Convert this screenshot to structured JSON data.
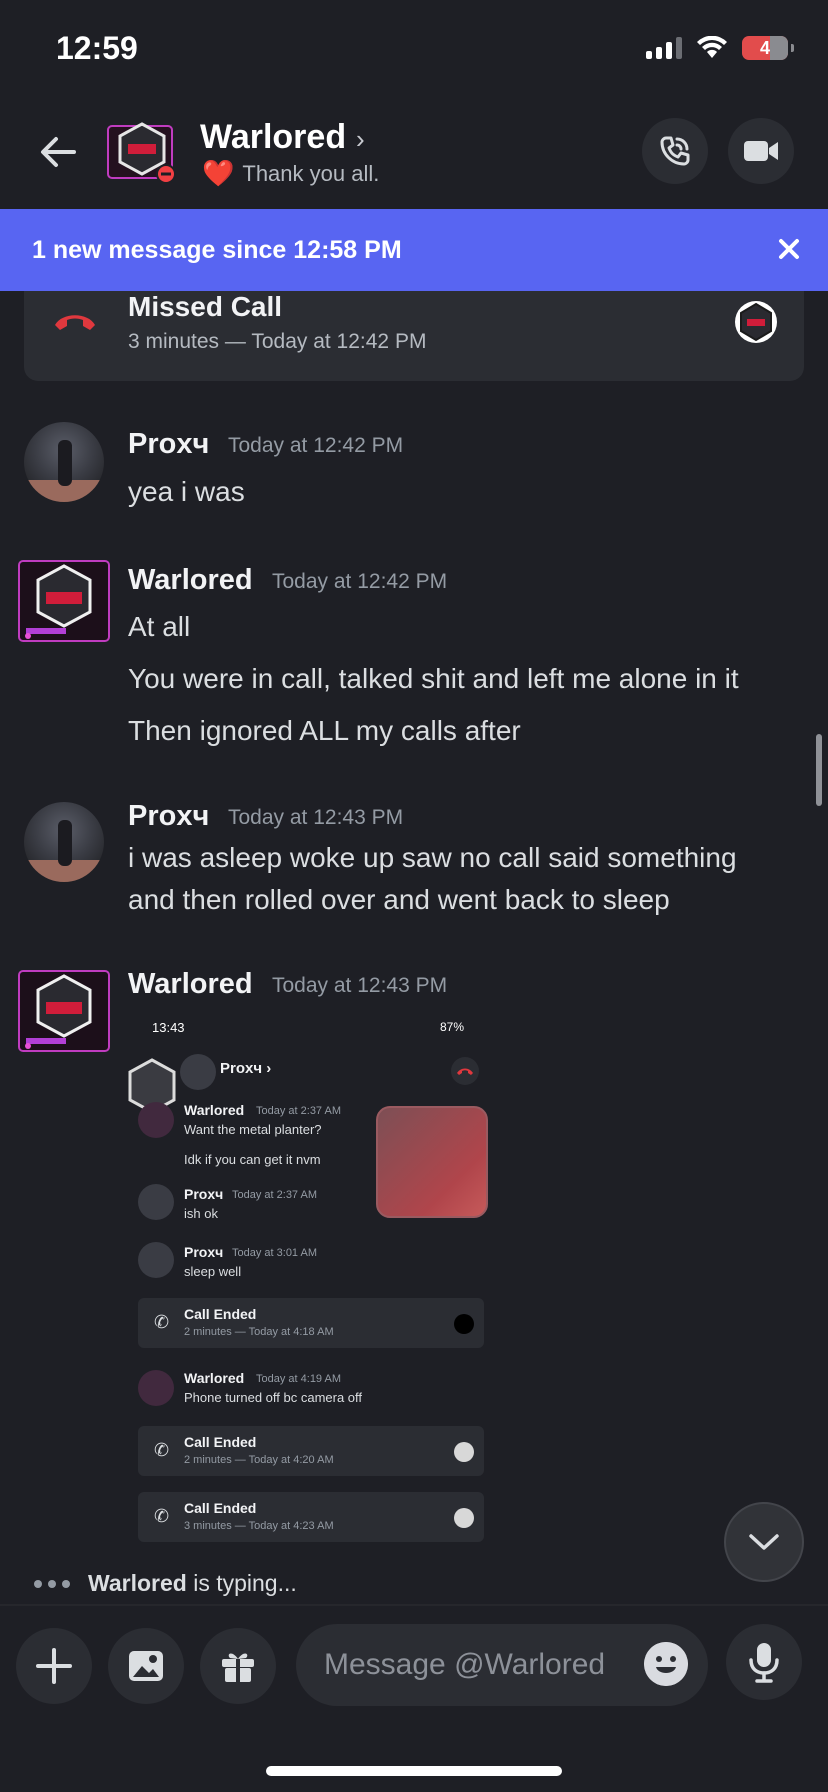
{
  "status_bar": {
    "time": "12:59",
    "battery": "4"
  },
  "header": {
    "name": "Warlored",
    "chevron": "›",
    "status_emoji": "❤️",
    "status_text": "Thank you all."
  },
  "banner": {
    "text": "1 new message since 12:58 PM",
    "close": "✕"
  },
  "missed_call": {
    "title": "Missed Call",
    "subtitle": "3 minutes — Today at 12:42 PM"
  },
  "messages": [
    {
      "author": "Proxч",
      "timestamp": "Today at 12:42 PM",
      "lines": [
        "yea i was"
      ]
    },
    {
      "author": "Warlored",
      "timestamp": "Today at 12:42 PM",
      "lines": [
        "At all",
        "You were in call, talked shit and left me alone in it",
        "Then ignored ALL my calls after"
      ]
    },
    {
      "author": "Proxч",
      "timestamp": "Today at 12:43 PM",
      "lines": [
        "i was asleep woke up saw no call said something",
        "and then rolled over and went back to sleep"
      ]
    },
    {
      "author": "Warlored",
      "timestamp": "Today at 12:43 PM",
      "lines": []
    }
  ],
  "attachment": {
    "status_time": "13:43",
    "status_right": "87%",
    "header_name": "Proxч ›",
    "items": [
      {
        "author": "Warlored",
        "timestamp": "Today at 2:37 AM",
        "lines": [
          "Want the metal planter?",
          "Idk if you can get it nvm"
        ]
      },
      {
        "author": "Proxч",
        "timestamp": "Today at 2:37 AM",
        "lines": [
          "ish ok"
        ]
      },
      {
        "author": "Proxч",
        "timestamp": "Today at 3:01 AM",
        "lines": [
          "sleep well"
        ]
      },
      {
        "card_title": "Call Ended",
        "card_sub": "2 minutes — Today at 4:18 AM"
      },
      {
        "author": "Warlored",
        "timestamp": "Today at 4:19 AM",
        "lines": [
          "Phone turned off bc camera off"
        ]
      },
      {
        "card_title": "Call Ended",
        "card_sub": "2 minutes — Today at 4:20 AM"
      },
      {
        "card_title": "Call Ended",
        "card_sub": "3 minutes — Today at 4:23 AM"
      }
    ]
  },
  "typing": {
    "name": "Warlored",
    "text": " is typing..."
  },
  "composer": {
    "placeholder": "Message @Warlored"
  },
  "colors": {
    "accent": "#5865f2",
    "background": "#1e1f25",
    "missed_red": "#e0383e"
  },
  "icons": [
    "back-arrow-icon",
    "phone-call-icon",
    "video-camera-icon",
    "close-icon",
    "missed-call-icon",
    "chevron-down-icon",
    "plus-icon",
    "image-icon",
    "gift-icon",
    "emoji-icon",
    "microphone-icon"
  ]
}
